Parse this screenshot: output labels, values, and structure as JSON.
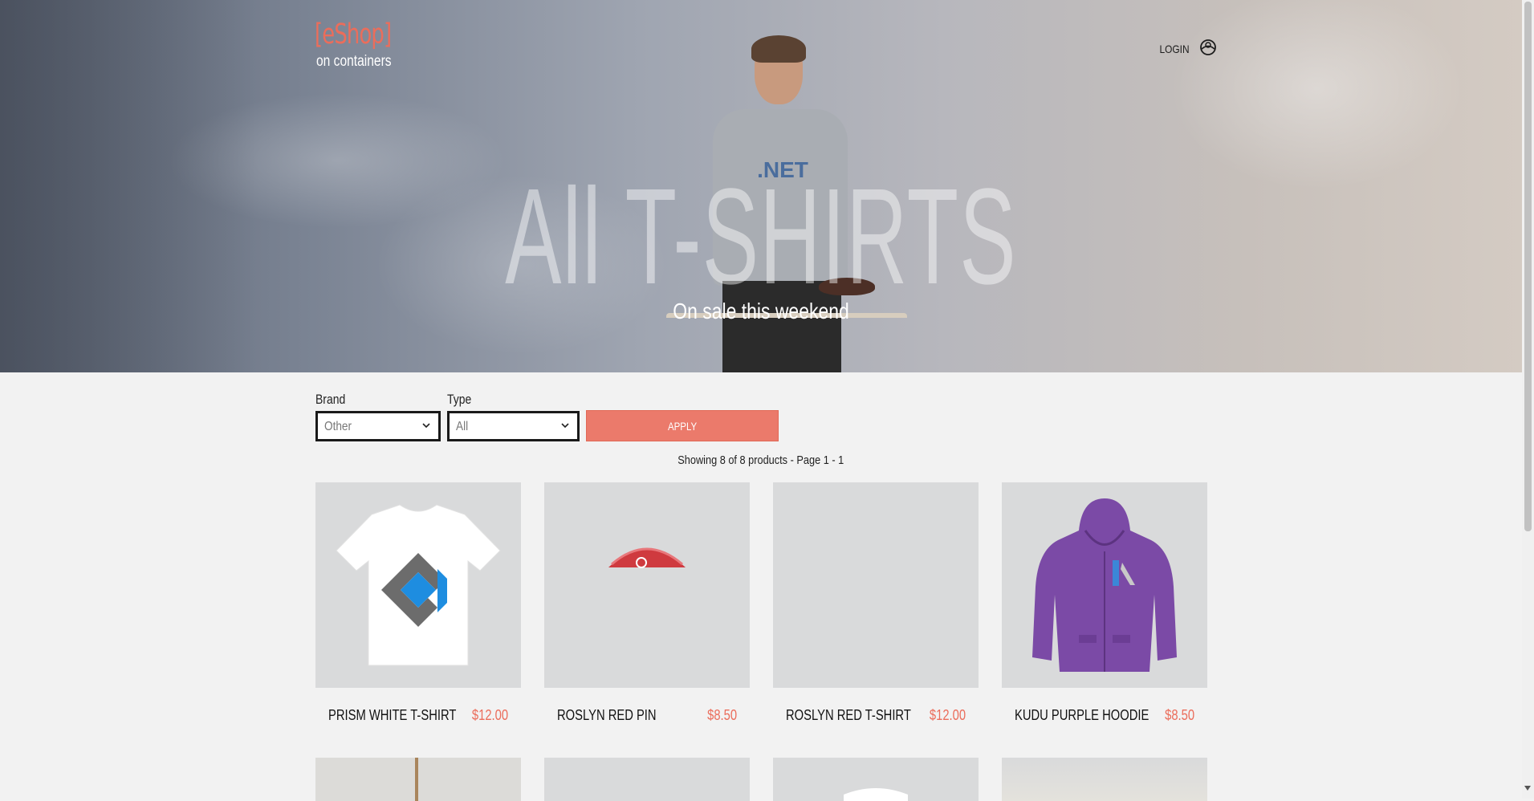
{
  "header": {
    "logo": "[eShop]",
    "subtitle": "on containers",
    "login_label": "LOGIN"
  },
  "hero": {
    "title": "All T-SHIRTS",
    "shirt_print": ".NET",
    "subtitle": "On sale this weekend"
  },
  "filters": {
    "brand_label": "Brand",
    "brand_value": "Other",
    "type_label": "Type",
    "type_value": "All",
    "apply_label": "APPLY"
  },
  "results": {
    "summary": "Showing 8 of 8 products - Page 1 - 1"
  },
  "products": [
    {
      "name": "PRISM WHITE T-SHIRT",
      "price": "$12.00"
    },
    {
      "name": "ROSLYN RED PIN",
      "price": "$8.50"
    },
    {
      "name": "ROSLYN RED T-SHIRT",
      "price": "$12.00"
    },
    {
      "name": "KUDU PURPLE HOODIE",
      "price": "$8.50"
    }
  ],
  "colors": {
    "accent": "#eb6d5b",
    "apply_button": "#eb7a6b",
    "page_background": "#f2f2f2",
    "card_background": "#d9dadb"
  },
  "icons": {
    "login": "user-icon",
    "dropdown": "chevron-down-icon"
  }
}
